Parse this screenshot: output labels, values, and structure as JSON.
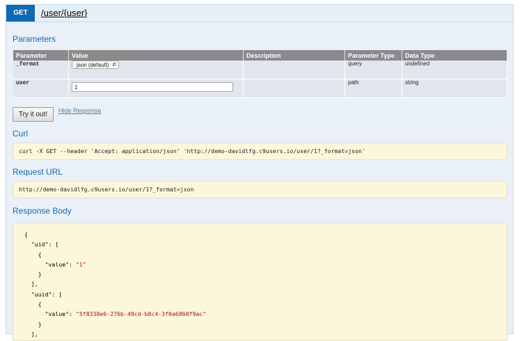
{
  "operation": {
    "method": "GET",
    "path": "/user/{user}"
  },
  "parameters": {
    "title": "Parameters",
    "columns": [
      "Parameter",
      "Value",
      "Description",
      "Parameter Type",
      "Data Type"
    ],
    "rows": [
      {
        "name": "_format",
        "value": "json (default)",
        "description": "",
        "param_type": "query",
        "data_type": "undefined"
      },
      {
        "name": "user",
        "value": "1",
        "description": "",
        "param_type": "path",
        "data_type": "string"
      }
    ]
  },
  "actions": {
    "try_label": "Try it out!",
    "hide_label": "Hide Response"
  },
  "curl": {
    "title": "Curl",
    "command": "curl -X GET --header 'Accept: application/json' 'http://demo-davidlfg.c9users.io/user/1?_format=json'"
  },
  "request_url": {
    "title": "Request URL",
    "url": "http://demo-davidlfg.c9users.io/user/1?_format=json"
  },
  "response_body": {
    "title": "Response Body",
    "lines": [
      {
        "indent": "",
        "text": "{",
        "str": ""
      },
      {
        "indent": "  ",
        "text": "\"uid\": [",
        "str": ""
      },
      {
        "indent": "    ",
        "text": "{",
        "str": ""
      },
      {
        "indent": "      ",
        "text": "\"value\": ",
        "str": "\"1\""
      },
      {
        "indent": "    ",
        "text": "}",
        "str": ""
      },
      {
        "indent": "  ",
        "text": "],",
        "str": ""
      },
      {
        "indent": "  ",
        "text": "\"uuid\": [",
        "str": ""
      },
      {
        "indent": "    ",
        "text": "{",
        "str": ""
      },
      {
        "indent": "      ",
        "text": "\"value\": ",
        "str": "\"5f8338e6-276b-49cd-b8c4-3f0a6860f9ac\""
      },
      {
        "indent": "    ",
        "text": "}",
        "str": ""
      },
      {
        "indent": "  ",
        "text": "],",
        "str": ""
      }
    ]
  },
  "colors": {
    "method_bg": "#0f6ab4",
    "section_title": "#0f6ab4",
    "code_bg": "#fcf6db",
    "header_bg": "#8a8a8a"
  }
}
